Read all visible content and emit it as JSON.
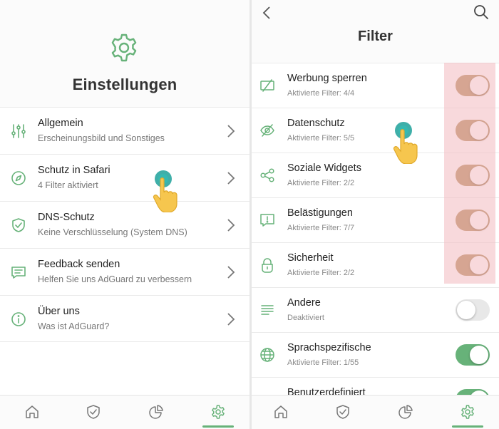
{
  "colors": {
    "accent": "#67b279",
    "toggle_on_highlighted": "#b48c5b",
    "toggle_off": "#e8e8e8",
    "highlight": "#f3b9bf"
  },
  "settings": {
    "title": "Einstellungen",
    "items": [
      {
        "title": "Allgemein",
        "subtitle": "Erscheinungsbild und Sonstiges",
        "icon": "sliders-icon"
      },
      {
        "title": "Schutz in Safari",
        "subtitle": "4 Filter aktiviert",
        "icon": "compass-icon"
      },
      {
        "title": "DNS-Schutz",
        "subtitle": "Keine Verschlüsselung (System DNS)",
        "icon": "shield-icon"
      },
      {
        "title": "Feedback senden",
        "subtitle": "Helfen Sie uns AdGuard zu verbessern",
        "icon": "message-icon"
      },
      {
        "title": "Über uns",
        "subtitle": "Was ist AdGuard?",
        "icon": "info-icon"
      }
    ]
  },
  "filter": {
    "title": "Filter",
    "items": [
      {
        "title": "Werbung sperren",
        "subtitle": "Aktivierte Filter: 4/4",
        "enabled": true,
        "icon": "ad-block-icon"
      },
      {
        "title": "Datenschutz",
        "subtitle": "Aktivierte Filter: 5/5",
        "enabled": true,
        "icon": "eye-slash-icon"
      },
      {
        "title": "Soziale Widgets",
        "subtitle": "Aktivierte Filter: 2/2",
        "enabled": true,
        "icon": "share-icon"
      },
      {
        "title": "Belästigungen",
        "subtitle": "Aktivierte Filter: 7/7",
        "enabled": true,
        "icon": "alert-message-icon"
      },
      {
        "title": "Sicherheit",
        "subtitle": "Aktivierte Filter: 2/2",
        "enabled": true,
        "icon": "lock-icon"
      },
      {
        "title": "Andere",
        "subtitle": "Deaktiviert",
        "enabled": false,
        "icon": "list-icon"
      },
      {
        "title": "Sprachspezifische",
        "subtitle": "Aktivierte Filter: 1/55",
        "enabled": true,
        "icon": "globe-icon"
      },
      {
        "title": "Benutzerdefiniert",
        "subtitle": "",
        "enabled": true,
        "icon": "code-icon"
      }
    ]
  },
  "tabbar": {
    "tabs": [
      "home-icon",
      "shield-check-icon",
      "pie-chart-icon",
      "gear-icon"
    ],
    "active": "gear-icon"
  }
}
